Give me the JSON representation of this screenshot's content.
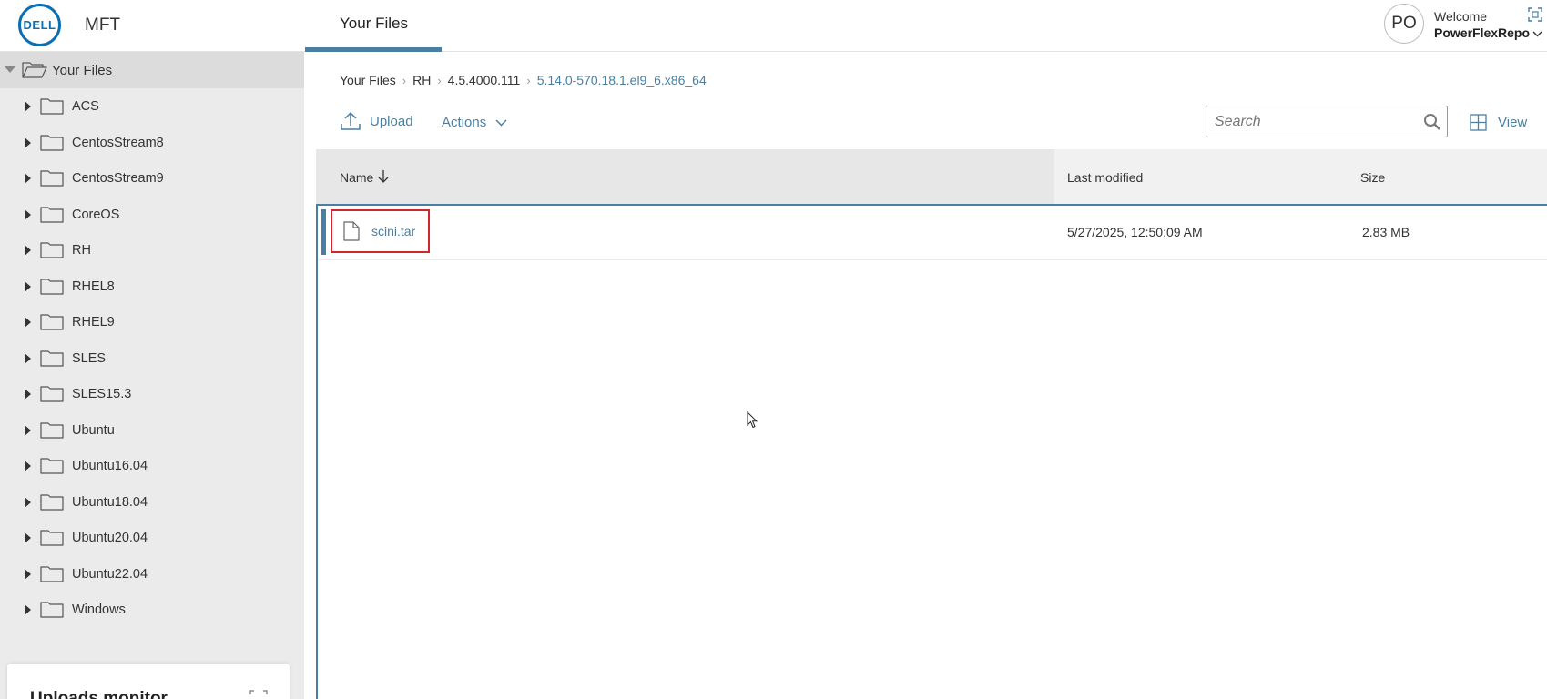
{
  "header": {
    "logo_text": "DELL",
    "app_name": "MFT",
    "main_tab": "Your Files",
    "avatar_initials": "PO",
    "welcome": "Welcome",
    "username": "PowerFlexRepo"
  },
  "sidebar": {
    "root_label": "Your Files",
    "items": [
      {
        "label": "ACS"
      },
      {
        "label": "CentosStream8"
      },
      {
        "label": "CentosStream9"
      },
      {
        "label": "CoreOS"
      },
      {
        "label": "RH"
      },
      {
        "label": "RHEL8"
      },
      {
        "label": "RHEL9"
      },
      {
        "label": "SLES"
      },
      {
        "label": "SLES15.3"
      },
      {
        "label": "Ubuntu"
      },
      {
        "label": "Ubuntu16.04"
      },
      {
        "label": "Ubuntu18.04"
      },
      {
        "label": "Ubuntu20.04"
      },
      {
        "label": "Ubuntu22.04"
      },
      {
        "label": "Windows"
      }
    ],
    "uploads_monitor": "Uploads monitor"
  },
  "breadcrumb": {
    "items": [
      "Your Files",
      "RH",
      "4.5.4000.111"
    ],
    "current": "5.14.0-570.18.1.el9_6.x86_64"
  },
  "toolbar": {
    "upload_label": "Upload",
    "actions_label": "Actions",
    "search_placeholder": "Search",
    "view_label": "View"
  },
  "table": {
    "columns": {
      "name": "Name",
      "modified": "Last modified",
      "size": "Size"
    },
    "rows": [
      {
        "name": "scini.tar",
        "modified": "5/27/2025, 12:50:09 AM",
        "size": "2.83 MB"
      }
    ]
  },
  "colors": {
    "accent": "#4a7fa2",
    "brand": "#0b6fb4",
    "highlight": "#d0262c"
  }
}
